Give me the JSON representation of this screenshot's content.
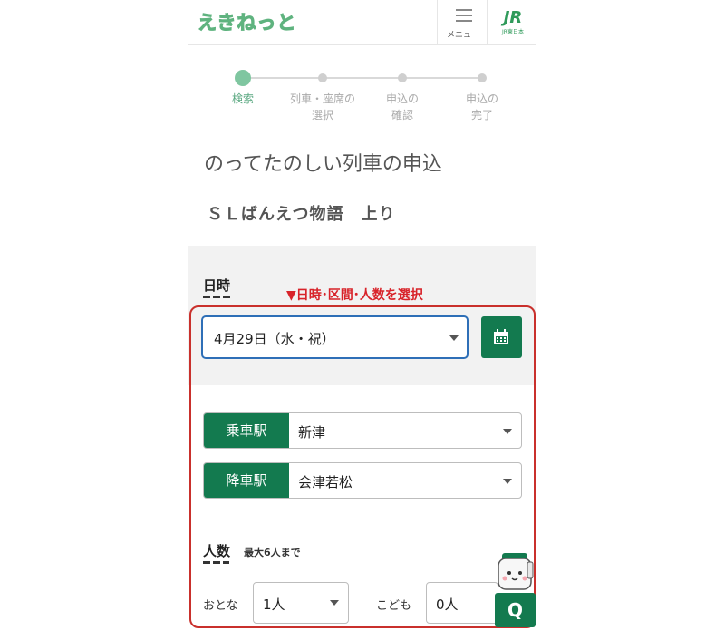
{
  "header": {
    "logo_text": "えきねっと",
    "menu_label": "メニュー",
    "jr_mark": "JR",
    "jr_sub": "JR東日本"
  },
  "stepper": {
    "steps": [
      {
        "label": "検索",
        "active": true
      },
      {
        "label": "列車・座席の\n選択",
        "active": false
      },
      {
        "label": "申込の\n確認",
        "active": false
      },
      {
        "label": "申込の\n完了",
        "active": false
      }
    ]
  },
  "page_title": "のってたのしい列車の申込",
  "train_name": "ＳＬばんえつ物語　上り",
  "datetime": {
    "label": "日時",
    "instruction": "▼日時･区間･人数を選択",
    "date_value": "4月29日（水・祝）"
  },
  "stations": {
    "board_label": "乗車駅",
    "board_value": "新津",
    "alight_label": "降車駅",
    "alight_value": "会津若松"
  },
  "persons": {
    "label": "人数",
    "note": "最大6人まで",
    "adult_label": "おとな",
    "adult_value": "1人",
    "child_label": "こども",
    "child_value": "0人"
  },
  "help_button": "Q",
  "colors": {
    "brand_green": "#137a4f",
    "step_active": "#7fc6a0",
    "instruction_red": "#d8232a",
    "focus_blue": "#2e6fb7"
  }
}
